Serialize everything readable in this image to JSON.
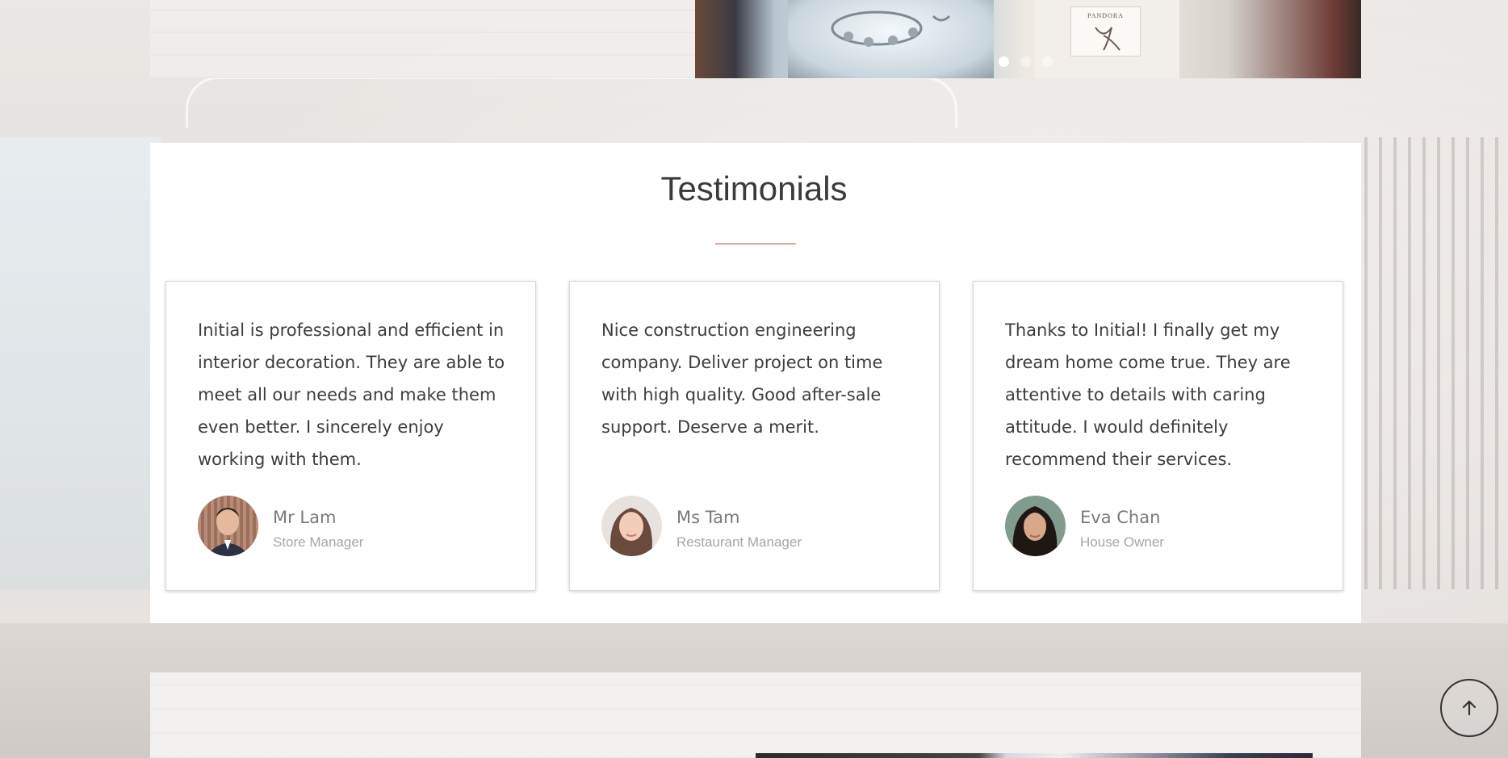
{
  "carousel": {
    "slide_count": 3,
    "active_index": 0,
    "store_sign": "PANDORA"
  },
  "testimonials": {
    "title": "Testimonials",
    "accent_color": "#e0aa9a",
    "items": [
      {
        "quote": "Initial is professional and efficient in interior decoration. They are able to meet all our needs and make them even better. I sincerely enjoy working with them.",
        "name": "Mr Lam",
        "role": "Store Manager",
        "avatar_icon": "man-avatar"
      },
      {
        "quote": "Nice construction engineering company. Deliver project on time with high quality. Good after-sale support. Deserve a merit.",
        "name": "Ms Tam",
        "role": "Restaurant Manager",
        "avatar_icon": "woman-avatar"
      },
      {
        "quote": "Thanks to Initial! I finally get my dream home come true. They are attentive to details with caring attitude. I would definitely recommend their services.",
        "name": "Eva Chan",
        "role": "House Owner",
        "avatar_icon": "woman-avatar"
      }
    ]
  },
  "back_to_top": {
    "icon": "arrow-up-icon"
  }
}
